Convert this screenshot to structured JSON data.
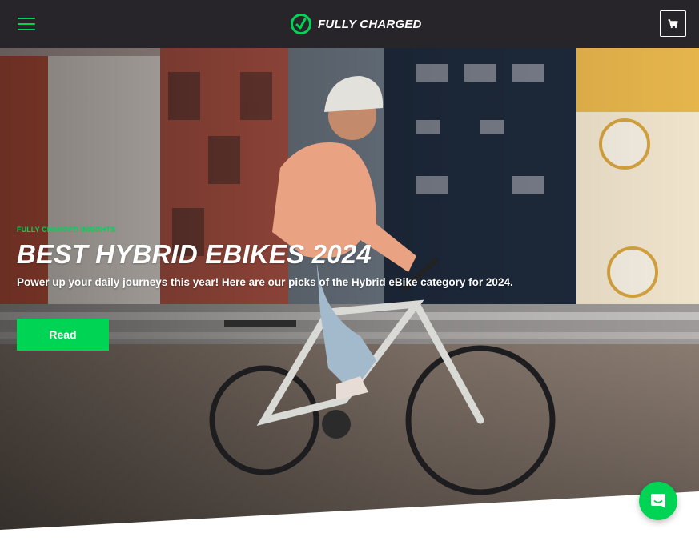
{
  "header": {
    "logo_text": "FULLY CHARGED",
    "menu_icon": "hamburger-menu-icon",
    "cart_icon": "shopping-cart-icon"
  },
  "hero": {
    "eyebrow": "FULLY CHARGED INSIGHTS",
    "title": "BEST HYBRID EBIKES 2024",
    "subtitle": "Power up your daily journeys this year! Here are our picks of the Hybrid eBike category for 2024.",
    "button_label": "Read",
    "image": "woman-riding-hybrid-ebike-photo"
  },
  "chat": {
    "icon": "chat-bubble-icon"
  },
  "colors": {
    "brand_green": "#00d455",
    "header_bg": "#27252a"
  }
}
